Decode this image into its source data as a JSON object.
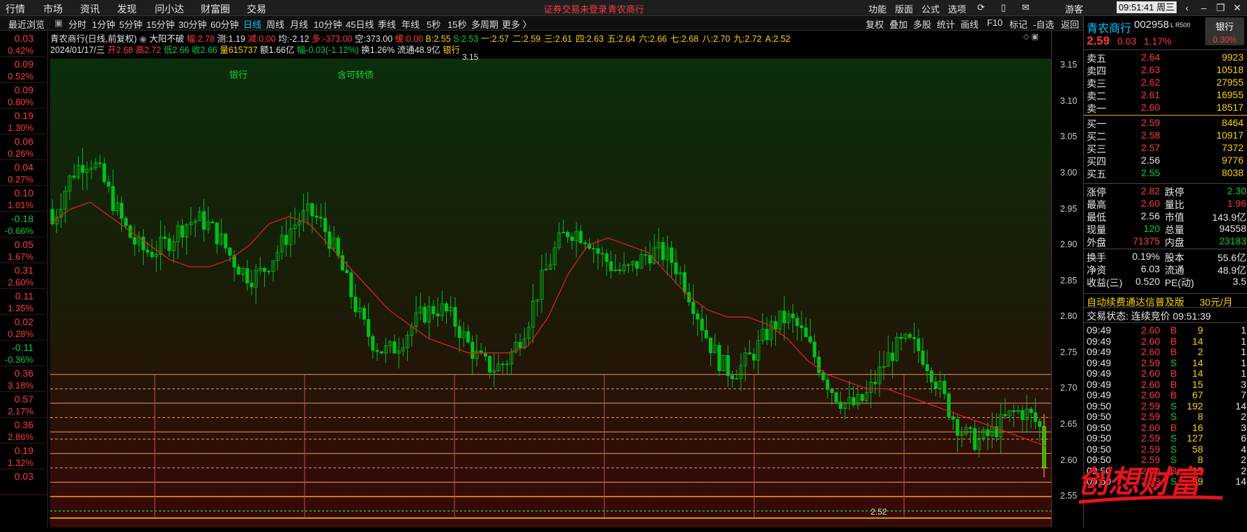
{
  "menubar": {
    "items": [
      "行情",
      "市场",
      "资讯",
      "发现",
      "问小达",
      "财富圈",
      "交易"
    ],
    "warning": "证券交易未登录",
    "warning_stock": "青农商行",
    "right_items": [
      "功能",
      "版面",
      "公式",
      "选项"
    ],
    "guest": "游客",
    "clock": "09:51:41 周三"
  },
  "toolbar": {
    "left_label": "最近浏览",
    "periods": [
      "分时",
      "1分钟",
      "5分钟",
      "15分钟",
      "30分钟",
      "60分钟",
      "日线",
      "周线",
      "月线",
      "10分钟",
      "45日线",
      "季线",
      "年线",
      "5秒",
      "15秒",
      "多周期",
      "更多 〉"
    ],
    "active": "日线",
    "right_items": [
      "复权",
      "叠加",
      "多股",
      "统计",
      "画线",
      "F10",
      "标记",
      "-自选",
      "返回"
    ]
  },
  "left_list": [
    {
      "v": "0.03",
      "p": "0.42%",
      "c": "red"
    },
    {
      "v": "0.09",
      "p": "0.52%",
      "c": "red"
    },
    {
      "v": "0.09",
      "p": "0.80%",
      "c": "red"
    },
    {
      "v": "0.19",
      "p": "1.30%",
      "c": "red"
    },
    {
      "v": "0.06",
      "p": "0.26%",
      "c": "red"
    },
    {
      "v": "0.04",
      "p": "0.27%",
      "c": "red"
    },
    {
      "v": "0.10",
      "p": "1.01%",
      "c": "red"
    },
    {
      "v": "-0.18",
      "p": "-0.66%",
      "c": "green"
    },
    {
      "v": "0.05",
      "p": "1.67%",
      "c": "red"
    },
    {
      "v": "0.31",
      "p": "2.60%",
      "c": "red"
    },
    {
      "v": "0.11",
      "p": "1.35%",
      "c": "red"
    },
    {
      "v": "0.02",
      "p": "0.28%",
      "c": "red"
    },
    {
      "v": "-0.11",
      "p": "-0.36%",
      "c": "green"
    },
    {
      "v": "0.36",
      "p": "3.18%",
      "c": "red"
    },
    {
      "v": "0.57",
      "p": "2.17%",
      "c": "red"
    },
    {
      "v": "0.36",
      "p": "2.86%",
      "c": "red"
    },
    {
      "v": "0.19",
      "p": "1.32%",
      "c": "red"
    },
    {
      "v": "0.03",
      "p": "",
      "c": "red"
    }
  ],
  "info": {
    "title": "青农商行(日线,前复权)",
    "indicator": "大阳不破",
    "fu_label": "幅:",
    "fu": "2.78",
    "ce_label": "测:",
    "ce": "1.19",
    "jian_label": "减:",
    "jian": "0.00",
    "jun_label": "均:",
    "jun": "-2.12",
    "duo_label": "多:",
    "duo": "-373.00",
    "kong_label": "空:",
    "kong": "373.00",
    "huan_label": "缓:",
    "huan": "0.00",
    "b_label": "B:",
    "b": "2.55",
    "s_label": "S:",
    "s": "2.53",
    "levels": [
      {
        "k": "一:",
        "v": "2.57"
      },
      {
        "k": "二:",
        "v": "2.59"
      },
      {
        "k": "三:",
        "v": "2.61"
      },
      {
        "k": "四:",
        "v": "2.63"
      },
      {
        "k": "五:",
        "v": "2.64"
      },
      {
        "k": "六:",
        "v": "2.66"
      },
      {
        "k": "七:",
        "v": "2.68"
      },
      {
        "k": "八:",
        "v": "2.70"
      },
      {
        "k": "九:",
        "v": "2.72"
      },
      {
        "k": "A:",
        "v": "2.52"
      }
    ],
    "date": "2024/01/17/三",
    "open": "开2.68",
    "high": "高2.72",
    "low": "低2.66",
    "close": "收2.66",
    "vol": "量615737",
    "amount": "额1.66亿",
    "amp": "幅-0.03(-1.12%)",
    "turnover": "换1.26%",
    "float": "流通48.9亿",
    "sector": "银行"
  },
  "chart_data": {
    "type": "candlestick",
    "ylim": [
      2.52,
      3.16
    ],
    "yticks": [
      "3.15",
      "3.10",
      "3.05",
      "3.00",
      "2.95",
      "2.90",
      "2.85",
      "2.80",
      "2.75",
      "2.70",
      "2.65",
      "2.60",
      "2.55"
    ],
    "annotations": [
      {
        "text": "银行"
      },
      {
        "text": "含可转债"
      }
    ],
    "high_label": "3.15",
    "low_label": "2.52",
    "h_levels": [
      2.72,
      2.7,
      2.68,
      2.66,
      2.64,
      2.63,
      2.61,
      2.59,
      2.57,
      2.55,
      2.53,
      2.52
    ],
    "ma_series": [
      2.93,
      2.95,
      2.96,
      2.94,
      2.92,
      2.9,
      2.88,
      2.87,
      2.87,
      2.88,
      2.9,
      2.93,
      2.94,
      2.93,
      2.9,
      2.87,
      2.84,
      2.81,
      2.79,
      2.77,
      2.76,
      2.75,
      2.75,
      2.75,
      2.76,
      2.8,
      2.86,
      2.9,
      2.91,
      2.9,
      2.89,
      2.86,
      2.83,
      2.81,
      2.8,
      2.8,
      2.79,
      2.77,
      2.74,
      2.72,
      2.71,
      2.7,
      2.7,
      2.69,
      2.68,
      2.67,
      2.66,
      2.65,
      2.64,
      2.63,
      2.62
    ]
  },
  "right": {
    "name": "青农商行",
    "code": "002958",
    "tag": "L R500",
    "sector_btn": "银行",
    "sector_pct": "0.30%",
    "price": "2.59",
    "chg": "0.03",
    "pct": "1.17%",
    "asks": [
      {
        "l": "卖五",
        "p": "2.64",
        "v": "9923"
      },
      {
        "l": "卖四",
        "p": "2.63",
        "v": "10518"
      },
      {
        "l": "卖三",
        "p": "2.62",
        "v": "27955"
      },
      {
        "l": "卖二",
        "p": "2.61",
        "v": "16955"
      },
      {
        "l": "卖一",
        "p": "2.60",
        "v": "18517"
      }
    ],
    "bids": [
      {
        "l": "买一",
        "p": "2.59",
        "v": "8464"
      },
      {
        "l": "买二",
        "p": "2.58",
        "v": "10917"
      },
      {
        "l": "买三",
        "p": "2.57",
        "v": "7372"
      },
      {
        "l": "买四",
        "p": "2.56",
        "v": "9776"
      },
      {
        "l": "买五",
        "p": "2.55",
        "v": "8038"
      }
    ],
    "stats": [
      {
        "a": "涨停",
        "av": "2.82",
        "ac": "red",
        "b": "跌停",
        "bv": "2.30",
        "bc": "green"
      },
      {
        "a": "最高",
        "av": "2.60",
        "ac": "red",
        "b": "量比",
        "bv": "1.96",
        "bc": "red"
      },
      {
        "a": "最低",
        "av": "2.56",
        "ac": "white",
        "b": "市值",
        "bv": "143.9亿",
        "bc": "white"
      },
      {
        "a": "现量",
        "av": "120",
        "ac": "green",
        "b": "总量",
        "bv": "94558",
        "bc": "white"
      },
      {
        "a": "外盘",
        "av": "71375",
        "ac": "red",
        "b": "内盘",
        "bv": "23183",
        "bc": "green"
      },
      {
        "a": "换手",
        "av": "0.19%",
        "ac": "white",
        "b": "股本",
        "bv": "55.6亿",
        "bc": "white"
      },
      {
        "a": "净资",
        "av": "6.03",
        "ac": "white",
        "b": "流通",
        "bv": "48.9亿",
        "bc": "white"
      },
      {
        "a": "收益(三)",
        "av": "0.520",
        "ac": "white",
        "b": "PE(动)",
        "bv": "3.5",
        "bc": "white"
      }
    ],
    "promo": "自动续费通达信普及版",
    "promo_price": "30元/月",
    "status": "交易状态: 连续竞价 09:51:39",
    "ticks": [
      {
        "t": "09:49",
        "p": "2.60",
        "v": "9",
        "s": "B",
        "n": "1"
      },
      {
        "t": "09:49",
        "p": "2.60",
        "v": "14",
        "s": "B",
        "n": "1"
      },
      {
        "t": "09:49",
        "p": "2.60",
        "v": "2",
        "s": "B",
        "n": "1"
      },
      {
        "t": "09:49",
        "p": "2.59",
        "v": "14",
        "s": "S",
        "n": "1"
      },
      {
        "t": "09:49",
        "p": "2.60",
        "v": "14",
        "s": "B",
        "n": "1"
      },
      {
        "t": "09:49",
        "p": "2.60",
        "v": "15",
        "s": "B",
        "n": "3"
      },
      {
        "t": "09:49",
        "p": "2.60",
        "v": "67",
        "s": "B",
        "n": "7"
      },
      {
        "t": "09:50",
        "p": "2.59",
        "v": "192",
        "s": "S",
        "n": "14"
      },
      {
        "t": "09:50",
        "p": "2.59",
        "v": "8",
        "s": "S",
        "n": "2"
      },
      {
        "t": "09:50",
        "p": "2.60",
        "v": "16",
        "s": "B",
        "n": "3"
      },
      {
        "t": "09:50",
        "p": "2.59",
        "v": "127",
        "s": "S",
        "n": "6"
      },
      {
        "t": "09:50",
        "p": "2.59",
        "v": "58",
        "s": "S",
        "n": "4"
      },
      {
        "t": "09:50",
        "p": "2.59",
        "v": "8",
        "s": "S",
        "n": "2"
      },
      {
        "t": "09:50",
        "p": "2.60",
        "v": "15",
        "s": "B",
        "n": "2"
      },
      {
        "t": "09:50",
        "p": "2.59",
        "v": "99",
        "s": "S",
        "n": "14"
      }
    ]
  },
  "watermark": {
    "text": "创想财富"
  }
}
